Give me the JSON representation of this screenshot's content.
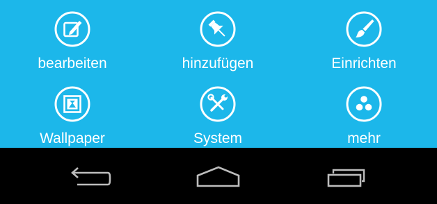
{
  "menu": {
    "items": [
      {
        "label": "bearbeiten",
        "icon": "edit-icon"
      },
      {
        "label": "hinzufügen",
        "icon": "pushpin-icon"
      },
      {
        "label": "Einrichten",
        "icon": "paintbrush-icon"
      },
      {
        "label": "Wallpaper",
        "icon": "wallpaper-icon"
      },
      {
        "label": "System",
        "icon": "tools-icon"
      },
      {
        "label": "mehr",
        "icon": "more-dots-icon"
      }
    ]
  },
  "navbar": {
    "buttons": [
      {
        "icon": "back-icon"
      },
      {
        "icon": "home-icon"
      },
      {
        "icon": "recent-apps-icon"
      }
    ]
  },
  "colors": {
    "menu_background": "#1cb7ea",
    "navbar_background": "#000000",
    "icon_white": "#ffffff",
    "nav_icon_gray": "#bdbdbd"
  }
}
